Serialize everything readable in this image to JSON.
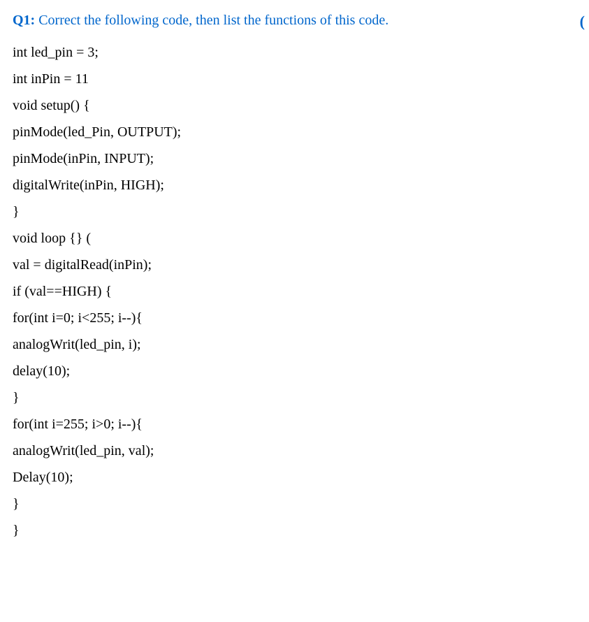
{
  "question": {
    "label": "Q1:",
    "text": " Correct the following code, then list the functions of this code.",
    "rightParen": "("
  },
  "code": {
    "lines": [
      "int led_pin = 3;",
      "int inPin = 11",
      "void setup() {",
      "pinMode(led_Pin, OUTPUT);",
      "pinMode(inPin, INPUT);",
      "digitalWrite(inPin, HIGH);",
      "}",
      "void loop {} (",
      " val = digitalRead(inPin);",
      "if (val==HIGH) {",
      "for(int i=0; i<255; i--){",
      "analogWrit(led_pin, i);",
      "delay(10);",
      "}",
      "for(int i=255; i>0; i--){",
      "analogWrit(led_pin, val);",
      "Delay(10);",
      "}",
      "}"
    ]
  }
}
